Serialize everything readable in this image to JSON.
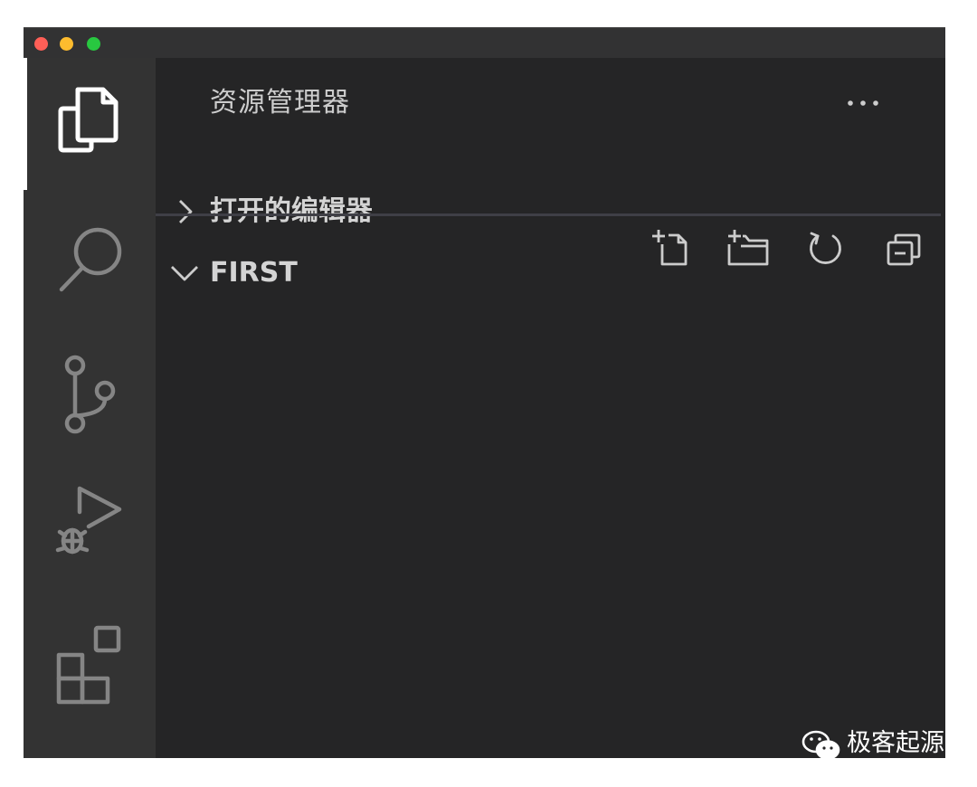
{
  "window": {
    "traffic_lights": {
      "close_color": "#ff5f57",
      "minimize_color": "#febc2e",
      "maximize_color": "#28c840"
    }
  },
  "activity_bar": {
    "items": [
      {
        "name": "explorer",
        "icon": "files-icon",
        "active": true
      },
      {
        "name": "search",
        "icon": "search-icon",
        "active": false
      },
      {
        "name": "source-control",
        "icon": "source-control-icon",
        "active": false
      },
      {
        "name": "run-and-debug",
        "icon": "run-debug-icon",
        "active": false
      },
      {
        "name": "extensions",
        "icon": "extensions-icon",
        "active": false
      }
    ]
  },
  "sidebar": {
    "title": "资源管理器",
    "more_icon": "ellipsis-icon",
    "sections": [
      {
        "label": "打开的编辑器",
        "expanded": false
      },
      {
        "label": "FIRST",
        "expanded": true
      }
    ],
    "folder_actions": [
      {
        "name": "new-file",
        "icon": "new-file-icon"
      },
      {
        "name": "new-folder",
        "icon": "new-folder-icon"
      },
      {
        "name": "refresh",
        "icon": "refresh-icon"
      },
      {
        "name": "collapse-all",
        "icon": "collapse-all-icon"
      }
    ]
  },
  "watermark": {
    "text": "极客起源",
    "icon": "wechat-icon"
  },
  "colors": {
    "activity_bar_bg": "#333333",
    "sidebar_bg": "#252526",
    "titlebar_bg": "#323233",
    "icon_inactive": "#858585",
    "icon_active": "#ffffff",
    "text": "#cccccc"
  }
}
